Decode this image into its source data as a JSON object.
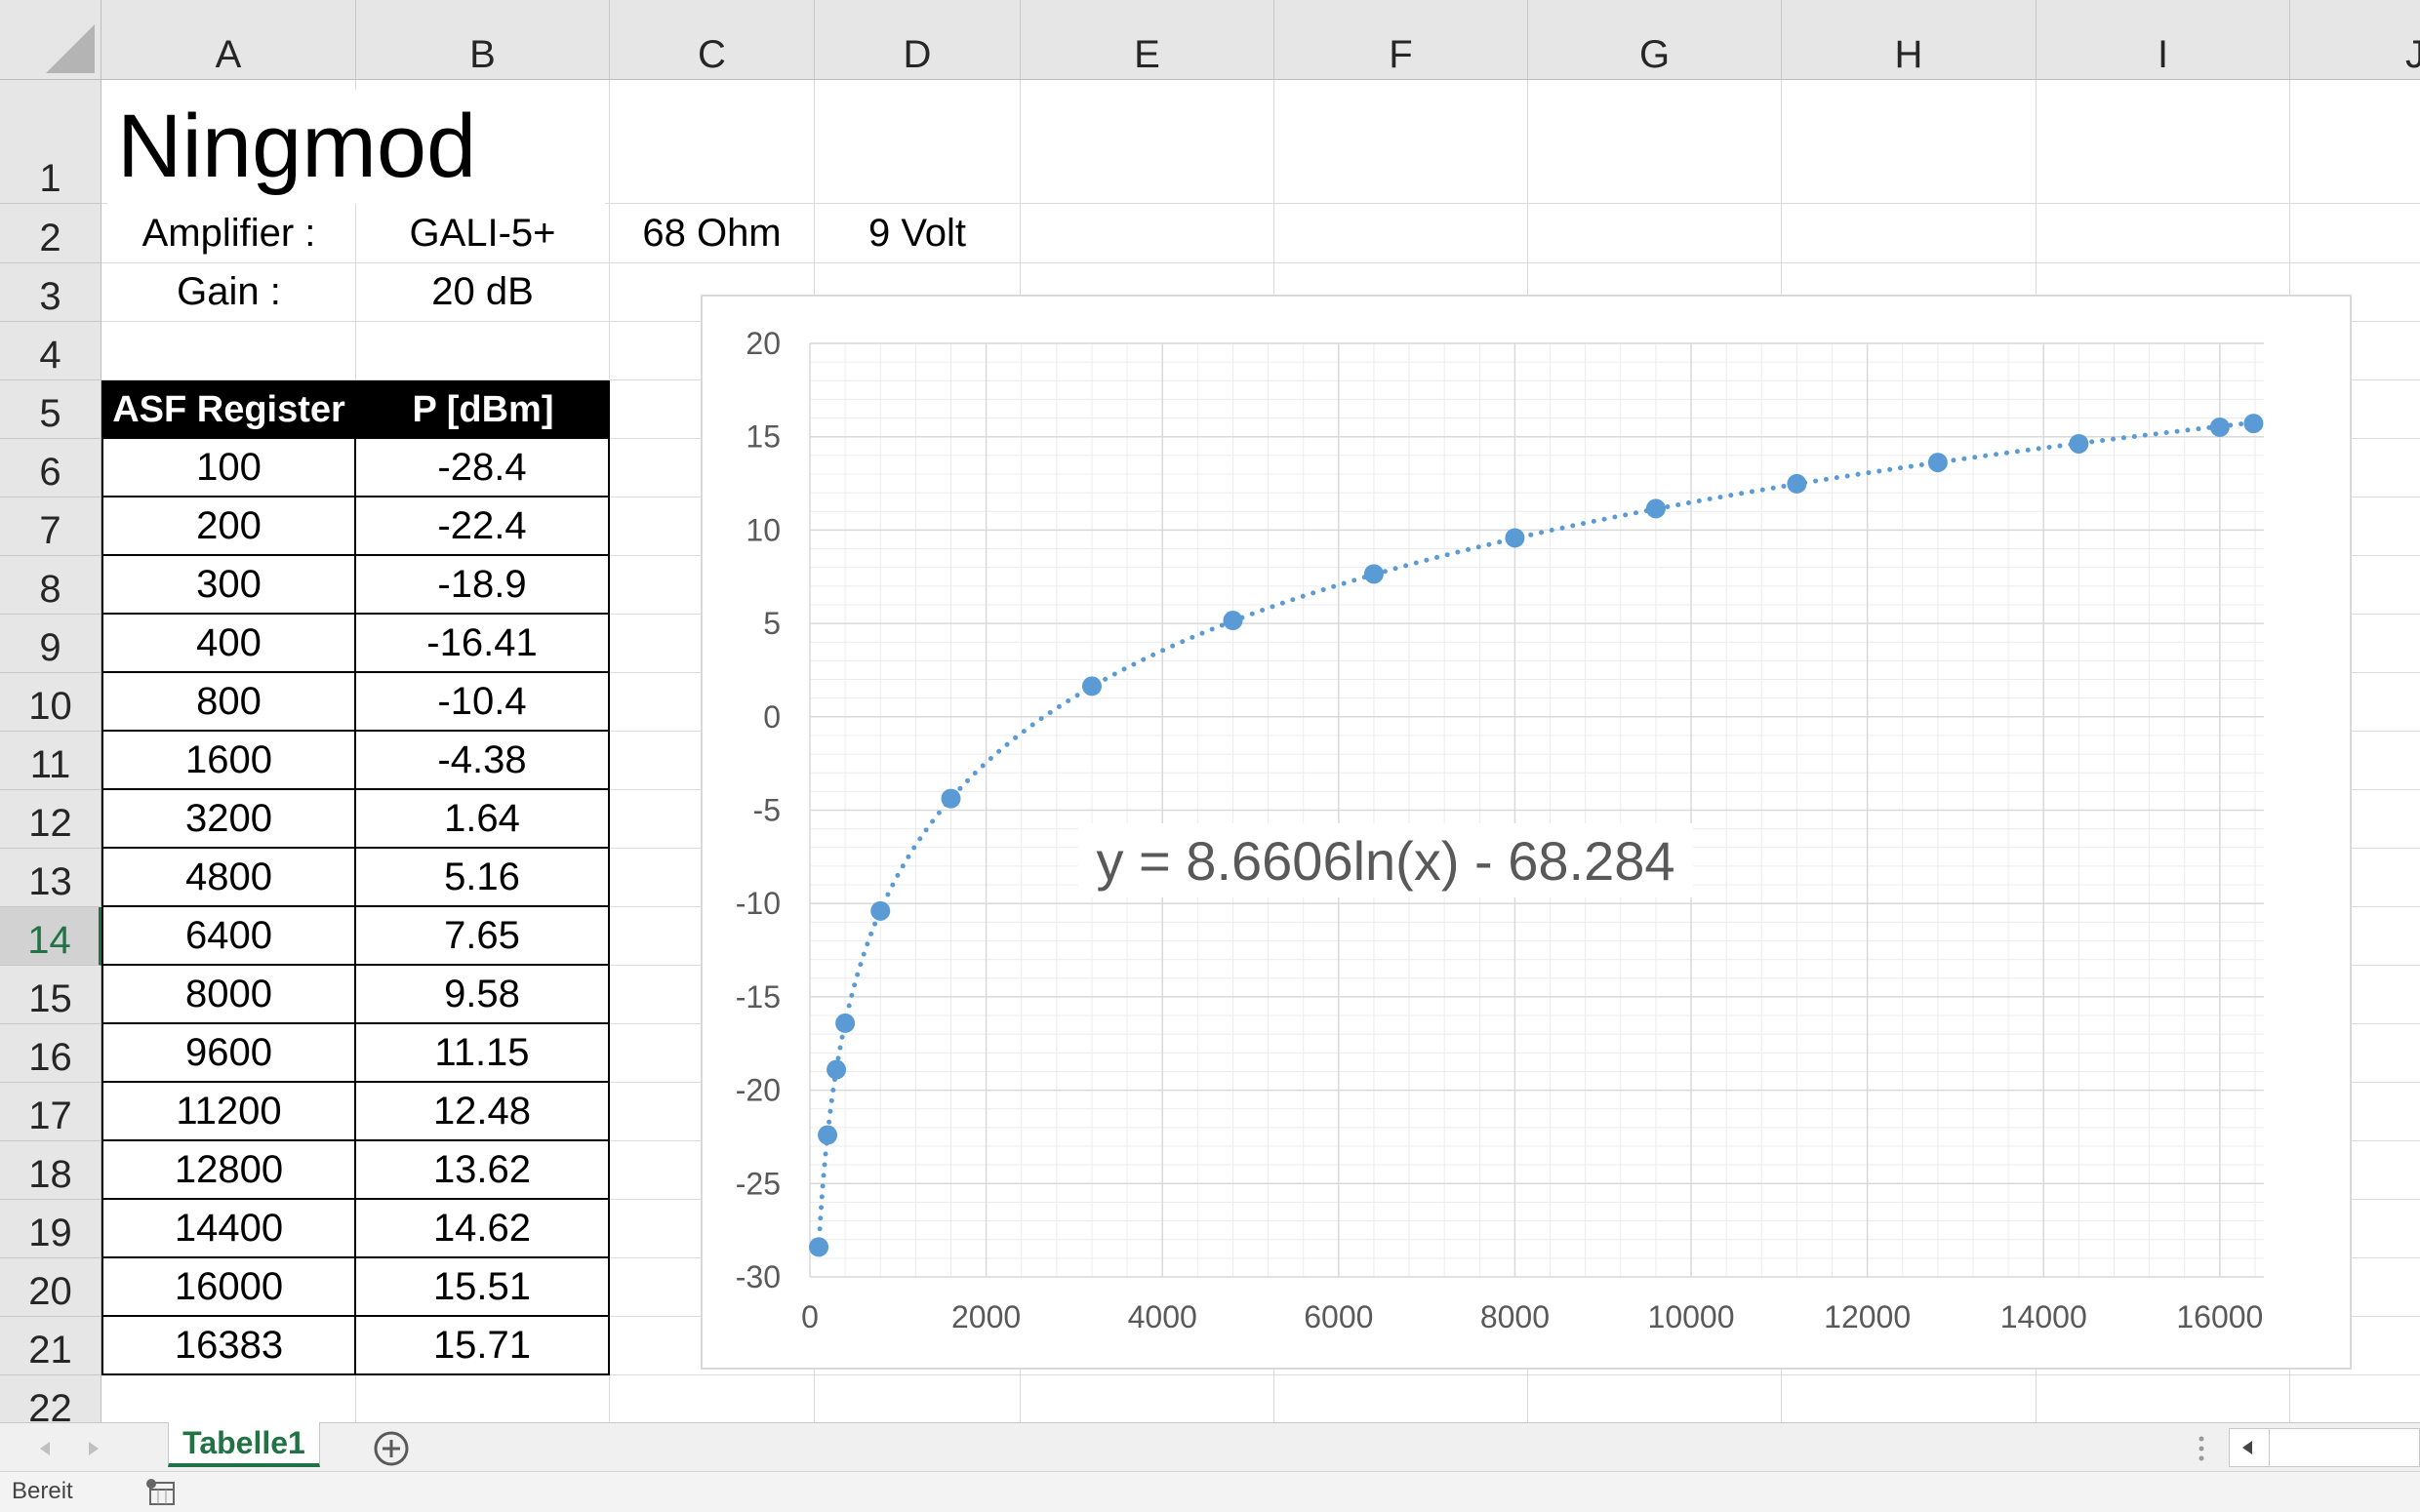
{
  "columns": [
    "A",
    "B",
    "C",
    "D",
    "E",
    "F",
    "G",
    "H",
    "I",
    "J"
  ],
  "rows": [
    "1",
    "2",
    "3",
    "4",
    "5",
    "6",
    "7",
    "8",
    "9",
    "10",
    "11",
    "12",
    "13",
    "14",
    "15",
    "16",
    "17",
    "18",
    "19",
    "20",
    "21",
    "22"
  ],
  "selected_row": "14",
  "cells": {
    "title": "Ningmod",
    "amplifier_label": "Amplifier :",
    "amplifier_value": "GALI-5+",
    "resistance": "68 Ohm",
    "voltage": "9 Volt",
    "gain_label": "Gain :",
    "gain_value": "20 dB"
  },
  "table": {
    "headers": [
      "ASF Register",
      "P [dBm]"
    ],
    "rows": [
      [
        "100",
        "-28.4"
      ],
      [
        "200",
        "-22.4"
      ],
      [
        "300",
        "-18.9"
      ],
      [
        "400",
        "-16.41"
      ],
      [
        "800",
        "-10.4"
      ],
      [
        "1600",
        "-4.38"
      ],
      [
        "3200",
        "1.64"
      ],
      [
        "4800",
        "5.16"
      ],
      [
        "6400",
        "7.65"
      ],
      [
        "8000",
        "9.58"
      ],
      [
        "9600",
        "11.15"
      ],
      [
        "11200",
        "12.48"
      ],
      [
        "12800",
        "13.62"
      ],
      [
        "14400",
        "14.62"
      ],
      [
        "16000",
        "15.51"
      ],
      [
        "16383",
        "15.71"
      ]
    ]
  },
  "chart_data": {
    "type": "scatter",
    "title": "",
    "xlabel": "",
    "ylabel": "",
    "x": [
      100,
      200,
      300,
      400,
      800,
      1600,
      3200,
      4800,
      6400,
      8000,
      9600,
      11200,
      12800,
      14400,
      16000,
      16383
    ],
    "y": [
      -28.4,
      -22.4,
      -18.9,
      -16.41,
      -10.4,
      -4.38,
      1.64,
      5.16,
      7.65,
      9.58,
      11.15,
      12.48,
      13.62,
      14.62,
      15.51,
      15.71
    ],
    "xlim": [
      0,
      16383
    ],
    "ylim": [
      -30,
      20
    ],
    "x_ticks": [
      "0",
      "2000",
      "4000",
      "6000",
      "8000",
      "10000",
      "12000",
      "14000",
      "16000"
    ],
    "y_ticks": [
      "20",
      "15",
      "10",
      "5",
      "0",
      "-5",
      "-10",
      "-15",
      "-20",
      "-25",
      "-30"
    ],
    "trendline": {
      "type": "logarithmic",
      "a": 8.6606,
      "b": -68.284,
      "style": "dotted"
    },
    "equation_label": "y = 8.6606ln(x) - 68.284",
    "grid": true,
    "legend": "none",
    "marker_color": "#5b9bd5"
  },
  "sheet_tabs": [
    {
      "label": "Tabelle1",
      "active": true
    }
  ],
  "status": {
    "text": "Bereit"
  },
  "icons": {
    "add_sheet": "plus-circle-icon",
    "nav_prev": "triangle-left-icon",
    "nav_next": "triangle-right-icon",
    "macro": "record-macro-icon"
  }
}
